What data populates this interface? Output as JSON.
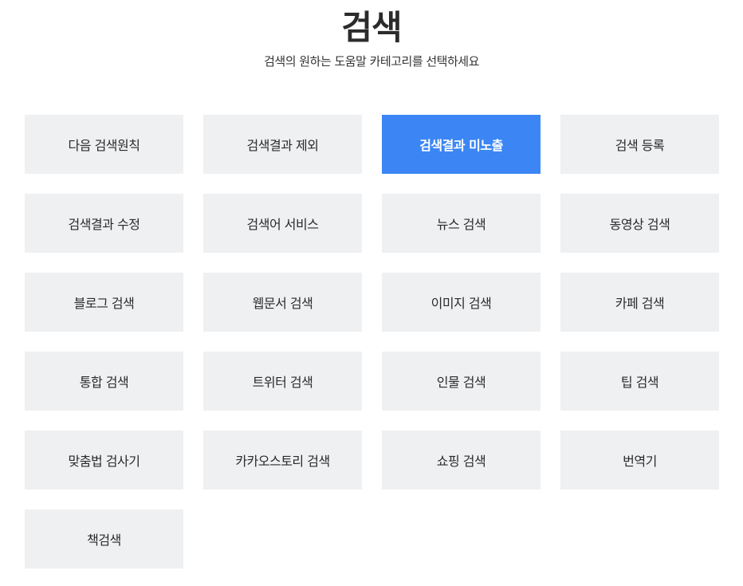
{
  "header": {
    "title": "검색",
    "subtitle": "검색의 원하는 도움말 카테고리를 선택하세요"
  },
  "colors": {
    "active_bg": "#3b86f4",
    "item_bg": "#eff0f2",
    "active_text": "#ffffff",
    "item_text": "#2a2a2a"
  },
  "categories": [
    {
      "label": "다음 검색원칙",
      "active": false
    },
    {
      "label": "검색결과 제외",
      "active": false
    },
    {
      "label": "검색결과 미노출",
      "active": true
    },
    {
      "label": "검색 등록",
      "active": false
    },
    {
      "label": "검색결과 수정",
      "active": false
    },
    {
      "label": "검색어 서비스",
      "active": false
    },
    {
      "label": "뉴스 검색",
      "active": false
    },
    {
      "label": "동영상 검색",
      "active": false
    },
    {
      "label": "블로그 검색",
      "active": false
    },
    {
      "label": "웹문서 검색",
      "active": false
    },
    {
      "label": "이미지 검색",
      "active": false
    },
    {
      "label": "카페 검색",
      "active": false
    },
    {
      "label": "통합 검색",
      "active": false
    },
    {
      "label": "트위터 검색",
      "active": false
    },
    {
      "label": "인물 검색",
      "active": false
    },
    {
      "label": "팁 검색",
      "active": false
    },
    {
      "label": "맞춤법 검사기",
      "active": false
    },
    {
      "label": "카카오스토리 검색",
      "active": false
    },
    {
      "label": "쇼핑 검색",
      "active": false
    },
    {
      "label": "번역기",
      "active": false
    },
    {
      "label": "책검색",
      "active": false
    }
  ]
}
